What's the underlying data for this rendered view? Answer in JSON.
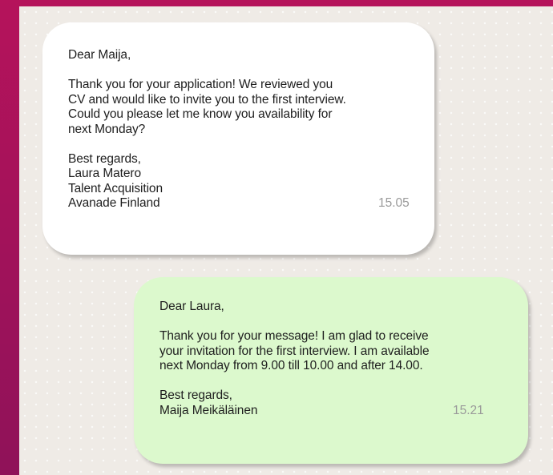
{
  "messages": [
    {
      "direction": "incoming",
      "greeting": "Dear Maija,",
      "body": [
        "Thank you for your application! We reviewed you",
        "CV and would like to invite you to the first interview.",
        "Could you please let me know you availability for",
        "next Monday?"
      ],
      "closing": "Best regards,",
      "signature": [
        "Laura Matero",
        "Talent Acquisition",
        "Avanade Finland"
      ],
      "time": "15.05"
    },
    {
      "direction": "outgoing",
      "greeting": "Dear Laura,",
      "body": [
        "Thank you for your message! I am glad to receive",
        "your invitation for the first interview. I am available",
        "next Monday from 9.00 till 10.00 and after 14.00."
      ],
      "closing": "Best regards,",
      "signature": [
        "Maija Meikäläinen"
      ],
      "time": "15.21"
    }
  ],
  "colors": {
    "frame": "#a8125a",
    "chat_background": "#efebe6",
    "incoming_bubble": "#ffffff",
    "outgoing_bubble": "#dcf9cd",
    "timestamp": "#9a9a9a"
  }
}
